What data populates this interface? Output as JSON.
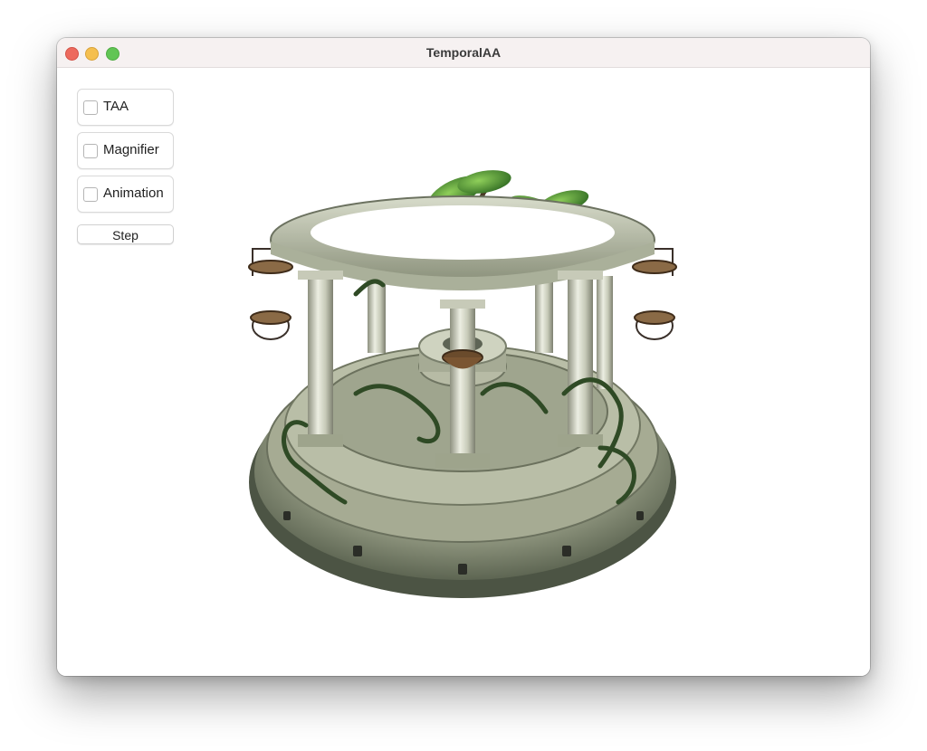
{
  "window": {
    "title": "TemporalAA"
  },
  "controls": {
    "checkboxes": [
      {
        "label": "TAA",
        "checked": false
      },
      {
        "label": "Magnifier",
        "checked": false
      },
      {
        "label": "Animation",
        "checked": false
      }
    ],
    "step_label": "Step"
  },
  "viewport": {
    "content": "3D rendered stone gazebo with columns, hanging bowls and a green plant"
  }
}
